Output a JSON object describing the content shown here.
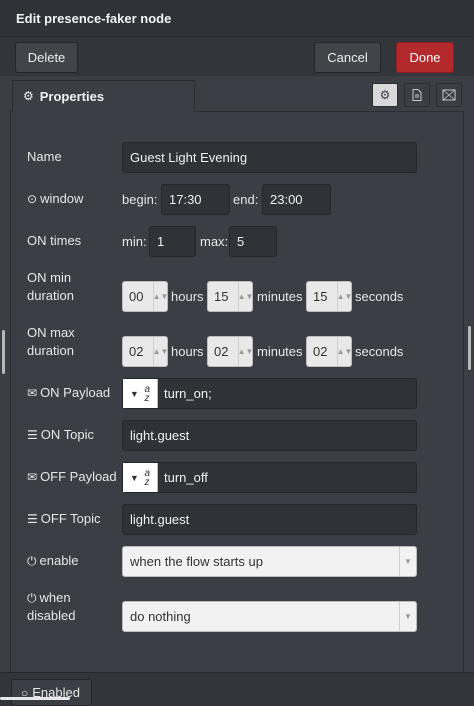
{
  "header": {
    "title": "Edit presence-faker node"
  },
  "toolbar": {
    "delete_label": "Delete",
    "cancel_label": "Cancel",
    "done_label": "Done"
  },
  "tabs": {
    "properties_label": "Properties",
    "icons": [
      "gear-icon",
      "description-icon",
      "appearance-icon"
    ]
  },
  "form": {
    "name": {
      "label": "Name",
      "value": "Guest Light Evening"
    },
    "window": {
      "label": "window",
      "begin_label": "begin:",
      "begin_value": "17:30",
      "end_label": "end:",
      "end_value": "23:00"
    },
    "on_times": {
      "label": "ON times",
      "min_label": "min:",
      "min_value": "1",
      "max_label": "max:",
      "max_value": "5"
    },
    "on_min_duration": {
      "label_line1": "ON min",
      "label_line2": "duration",
      "hours": "00",
      "minutes": "15",
      "seconds": "15",
      "hours_label": "hours",
      "minutes_label": "minutes",
      "seconds_label": "seconds"
    },
    "on_max_duration": {
      "label_line1": "ON max",
      "label_line2": "duration",
      "hours": "02",
      "minutes": "02",
      "seconds": "02",
      "hours_label": "hours",
      "minutes_label": "minutes",
      "seconds_label": "seconds"
    },
    "on_payload": {
      "label": "ON Payload",
      "type_glyph": "a",
      "type_glyph2": "z",
      "value": "turn_on;"
    },
    "on_topic": {
      "label": "ON Topic",
      "value": "light.guest"
    },
    "off_payload": {
      "label": "OFF Payload",
      "type_glyph": "a",
      "type_glyph2": "z",
      "value": "turn_off"
    },
    "off_topic": {
      "label": "OFF Topic",
      "value": "light.guest"
    },
    "enable": {
      "label": "enable",
      "value": "when the flow starts up"
    },
    "when_disabled": {
      "label_line1": "when",
      "label_line2": "disabled",
      "value": "do nothing"
    }
  },
  "footer": {
    "enabled_label": "Enabled"
  },
  "colors": {
    "background": "#3b3f45",
    "done_button": "#b3292c",
    "field_dark": "#2f3237"
  }
}
